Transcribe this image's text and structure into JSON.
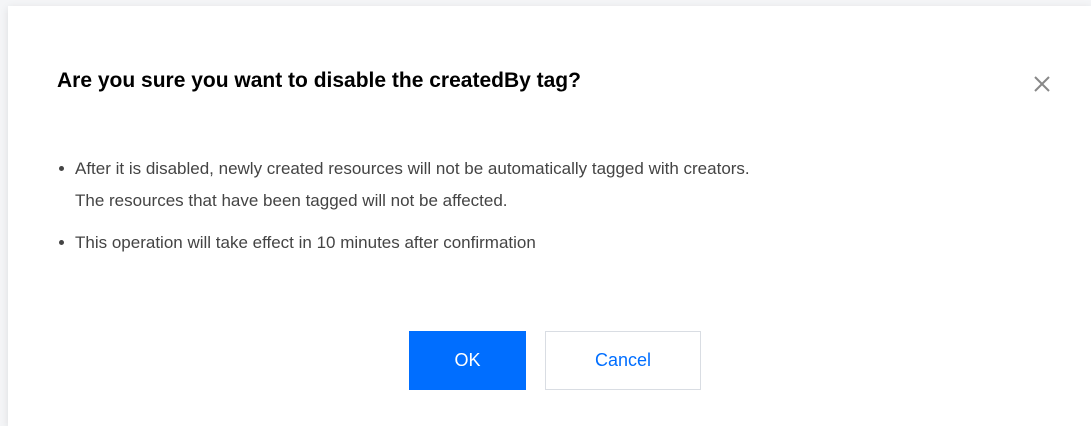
{
  "dialog": {
    "title": "Are you sure you want to disable the createdBy tag?",
    "close_icon": "close-icon",
    "bullets": [
      {
        "line1": "After it is disabled, newly created resources will not be automatically tagged with creators.",
        "line2": "The resources that have been tagged will not be affected."
      },
      {
        "line1": "This operation will take effect in 10 minutes after confirmation"
      }
    ],
    "ok_label": "OK",
    "cancel_label": "Cancel"
  },
  "colors": {
    "primary": "#006eff",
    "text": "#444444",
    "title": "#000000",
    "border": "#d9dde3"
  }
}
